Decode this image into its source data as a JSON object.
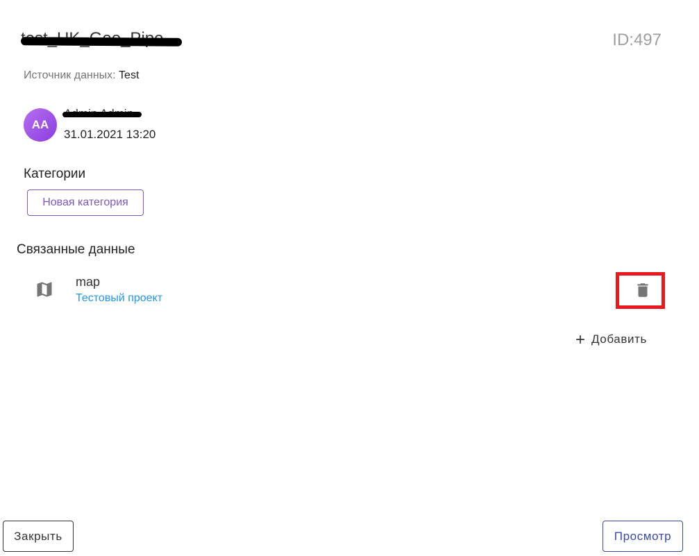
{
  "header": {
    "title": "test_UK_Geo_Pipe",
    "id_label": "ID:497"
  },
  "source": {
    "label": "Источник данных: ",
    "value": "Test"
  },
  "author": {
    "initials": "AA",
    "name": "Admin Admin",
    "date": "31.01.2021 13:20",
    "avatar_color": "#9b4ee6"
  },
  "categories": {
    "heading": "Категории",
    "new_button": "Новая категория"
  },
  "linked_data": {
    "heading": "Связанные данные",
    "items": [
      {
        "icon": "map-icon",
        "name": "map",
        "project": "Тестовый проект"
      }
    ],
    "add_label": "Добавить"
  },
  "footer": {
    "close_label": "Закрыть",
    "preview_label": "Просмотр"
  },
  "colors": {
    "accent_purple": "#7e57c2",
    "link_blue": "#2196f3",
    "preview_indigo": "#3949ab",
    "highlight_red": "#e8191f"
  }
}
